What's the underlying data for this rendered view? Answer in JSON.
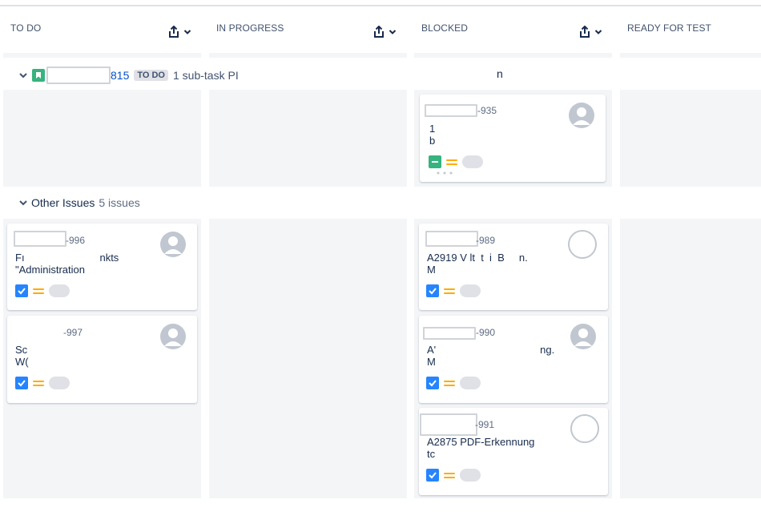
{
  "columns": [
    {
      "title": "TO DO"
    },
    {
      "title": "IN PROGRESS"
    },
    {
      "title": "BLOCKED"
    },
    {
      "title": "READY FOR TEST"
    }
  ],
  "parent_swimlane": {
    "key_suffix": "815",
    "status": "TO DO",
    "subtasks": "1 sub-task PI",
    "trailing": "n"
  },
  "other_swimlane": {
    "label": "Other Issues",
    "count": "5 issues"
  },
  "cards": {
    "blocked_935": {
      "key": "-935",
      "summary": "1\nb"
    },
    "todo_996": {
      "key": "-996",
      "summary": "Fı                          nkts\n\"Administration"
    },
    "todo_997": {
      "key": "-997",
      "summary": "Sc\nW("
    },
    "blocked_989": {
      "key": "-989",
      "summary": "A2919 V lt  t  i  B     n.\nM"
    },
    "blocked_990": {
      "key": "-990",
      "summary": "A'                                    ng.\nM"
    },
    "blocked_991": {
      "key": "-991",
      "summary": "A2875 PDF-Erkennung\ntc"
    }
  },
  "icons": {
    "export": "share-icon",
    "dropdown": "chevron-down-icon",
    "collapse": "chevron-down-icon",
    "story": "bookmark-icon",
    "task": "checkbox-icon",
    "priority": "priority-medium-icon",
    "avatar": "user-avatar-icon"
  },
  "colors": {
    "lane_bg": "#f4f5f7",
    "accent_blue": "#2684ff",
    "story_green": "#36b37e",
    "priority_medium": "#ffab00"
  }
}
